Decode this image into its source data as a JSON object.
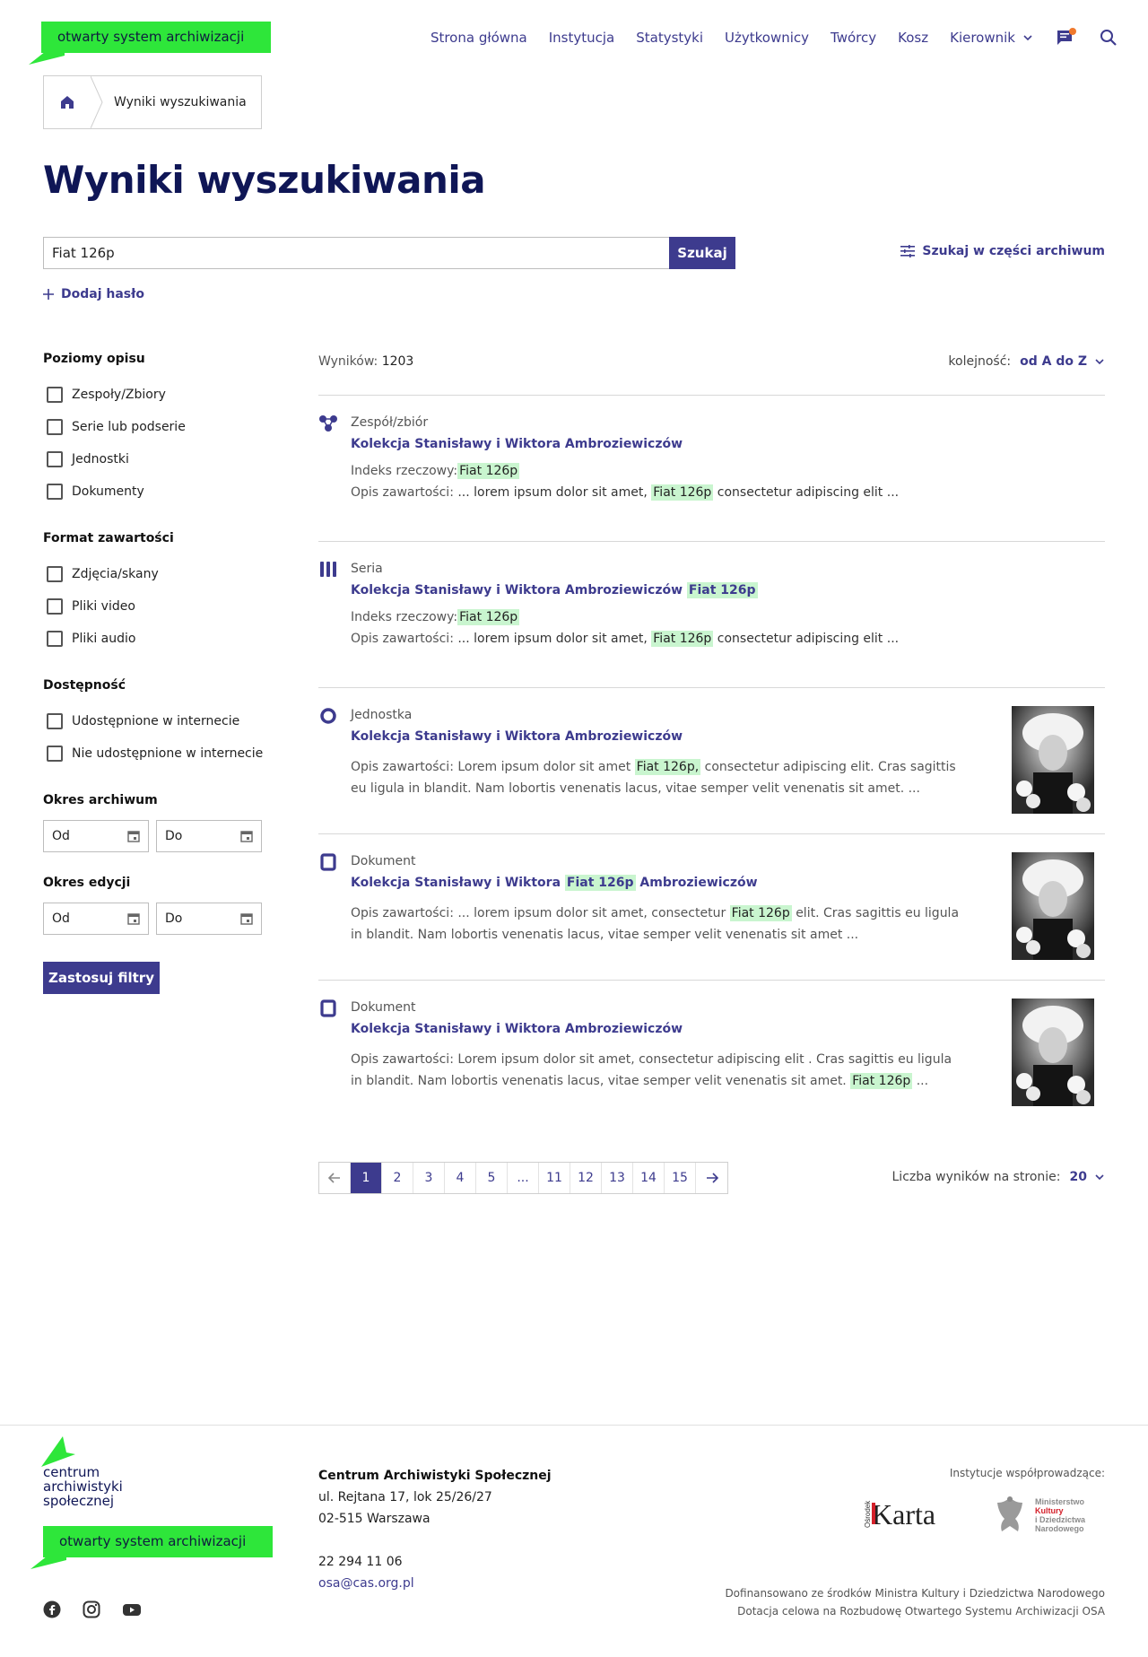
{
  "header": {
    "logo_text": "otwarty system archiwizacji",
    "nav": [
      "Strona główna",
      "Instytucja",
      "Statystyki",
      "Użytkownicy",
      "Twórcy",
      "Kosz"
    ],
    "user_menu": "Kierownik"
  },
  "breadcrumb": {
    "current": "Wyniki wyszukiwania"
  },
  "page": {
    "title": "Wyniki wyszukiwania"
  },
  "search": {
    "value": "Fiat 126p",
    "button": "Szukaj",
    "partial_search": "Szukaj w części archiwum",
    "add_term": "Dodaj hasło"
  },
  "filters": {
    "levels": {
      "title": "Poziomy opisu",
      "options": [
        "Zespoły/Zbiory",
        "Serie lub podserie",
        "Jednostki",
        "Dokumenty"
      ]
    },
    "format": {
      "title": "Format zawartości",
      "options": [
        "Zdjęcia/skany",
        "Pliki video",
        "Pliki audio"
      ]
    },
    "access": {
      "title": "Dostępność",
      "options": [
        "Udostępnione w internecie",
        "Nie udostępnione w internecie"
      ]
    },
    "archive_period": {
      "title": "Okres archiwum",
      "from": "Od",
      "to": "Do"
    },
    "edit_period": {
      "title": "Okres edycji",
      "from": "Od",
      "to": "Do"
    },
    "apply": "Zastosuj filtry"
  },
  "results": {
    "count_label": "Wyników:",
    "count": "1203",
    "sort_label": "kolejność:",
    "sort_value": "od A do Z",
    "items": [
      {
        "type": "Zespół/zbiór",
        "title": "Kolekcja Stanisławy i Wiktora Ambroziewiczów",
        "index_label": "Indeks rzeczowy:",
        "index_value": "Fiat 126p",
        "desc_label": "Opis zawartości:",
        "desc_pre": "... lorem ipsum dolor sit amet,",
        "desc_hl": "Fiat 126p",
        "desc_post": "consectetur adipiscing elit ..."
      },
      {
        "type": "Seria",
        "title": "Kolekcja Stanisławy i Wiktora Ambroziewiczów",
        "title_hl": "Fiat 126p",
        "index_label": "Indeks rzeczowy:",
        "index_value": "Fiat 126p",
        "desc_label": "Opis zawartości:",
        "desc_pre": "... lorem ipsum dolor sit amet,",
        "desc_hl": "Fiat 126p",
        "desc_post": "consectetur adipiscing elit ..."
      },
      {
        "type": "Jednostka",
        "title": "Kolekcja Stanisławy i Wiktora Ambroziewiczów",
        "desc_pre": "Opis zawartości: Lorem ipsum dolor sit amet",
        "desc_hl": "Fiat 126p,",
        "desc_post": "consectetur adipiscing elit. Cras sagittis eu ligula in blandit. Nam lobortis venenatis lacus, vitae semper velit venenatis sit amet. ..."
      },
      {
        "type": "Dokument",
        "title_pre": "Kolekcja Stanisławy i Wiktora",
        "title_hl": "Fiat 126p",
        "title_post": "Ambroziewiczów",
        "desc_pre": "Opis zawartości: ... lorem ipsum dolor sit amet, consectetur",
        "desc_hl": "Fiat 126p",
        "desc_post": "elit. Cras sagittis eu ligula in blandit. Nam lobortis venenatis lacus, vitae semper velit venenatis sit amet ..."
      },
      {
        "type": "Dokument",
        "title": "Kolekcja Stanisławy i Wiktora Ambroziewiczów",
        "desc_pre": "Opis zawartości: Lorem ipsum dolor sit amet, consectetur adipiscing elit . Cras sagittis eu ligula in blandit. Nam lobortis venenatis lacus, vitae semper velit venenatis sit amet.",
        "desc_hl": "Fiat 126p",
        "desc_post": "..."
      }
    ]
  },
  "pagination": {
    "pages": [
      "1",
      "2",
      "3",
      "4",
      "5",
      "...",
      "11",
      "12",
      "13",
      "14",
      "15"
    ],
    "current": "1",
    "per_page_label": "Liczba wyników na stronie:",
    "per_page": "20"
  },
  "footer": {
    "cas_logo": [
      "centrum",
      "archiwistyki",
      "społecznej"
    ],
    "logo_text": "otwarty system archiwizacji",
    "org_name": "Centrum Archiwistyki Społecznej",
    "address1": "ul. Rejtana 17, lok 25/26/27",
    "address2": "02-515 Warszawa",
    "phone": "22 294 11 06",
    "email": "osa@cas.org.pl",
    "co_label": "Instytucje współprowadzące:",
    "karta_logo": {
      "main": "Karta",
      "side": "Ośrodek"
    },
    "ministry_logo": [
      "Ministerstwo",
      "Kultury",
      "i Dziedzictwa",
      "Narodowego"
    ],
    "funding1": "Dofinansowano ze środków Ministra Kultury i Dziedzictwa Narodowego",
    "funding2": "Dotacja celowa na Rozbudowę Otwartego Systemu Archiwizacji OSA",
    "social": [
      "facebook-icon",
      "instagram-icon",
      "youtube-icon"
    ]
  },
  "colors": {
    "accent": "#3d3b8e",
    "logo_green": "#2ee63a",
    "highlight": "#c9f5cf",
    "title": "#0f1656",
    "notification": "#f0792d"
  }
}
